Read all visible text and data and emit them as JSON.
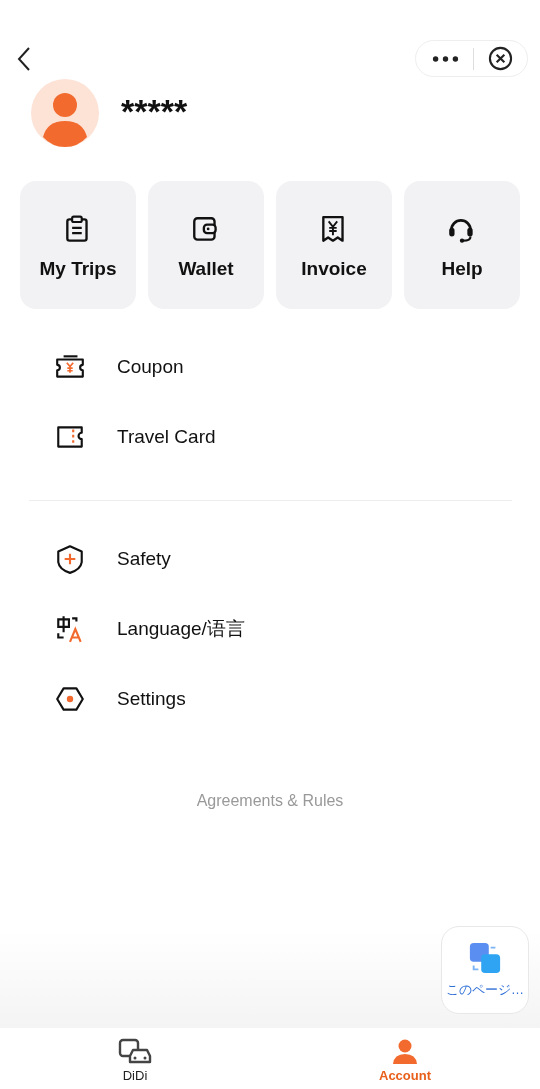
{
  "profile": {
    "name": "*****"
  },
  "quick_actions": [
    {
      "kind": "trips",
      "label": "My Trips"
    },
    {
      "kind": "wallet",
      "label": "Wallet"
    },
    {
      "kind": "invoice",
      "label": "Invoice"
    },
    {
      "kind": "help",
      "label": "Help"
    }
  ],
  "menu_groups": [
    [
      {
        "kind": "coupon",
        "label": "Coupon"
      },
      {
        "kind": "card",
        "label": "Travel Card"
      }
    ],
    [
      {
        "kind": "safety",
        "label": "Safety"
      },
      {
        "kind": "language",
        "label": "Language/语言"
      },
      {
        "kind": "settings",
        "label": "Settings"
      }
    ]
  ],
  "footer_link": "Agreements & Rules",
  "translate_button": {
    "label": "このページ…"
  },
  "tabs": [
    {
      "kind": "cars",
      "label": "DiDi",
      "selected": false
    },
    {
      "kind": "person",
      "label": "Account",
      "selected": true
    }
  ]
}
